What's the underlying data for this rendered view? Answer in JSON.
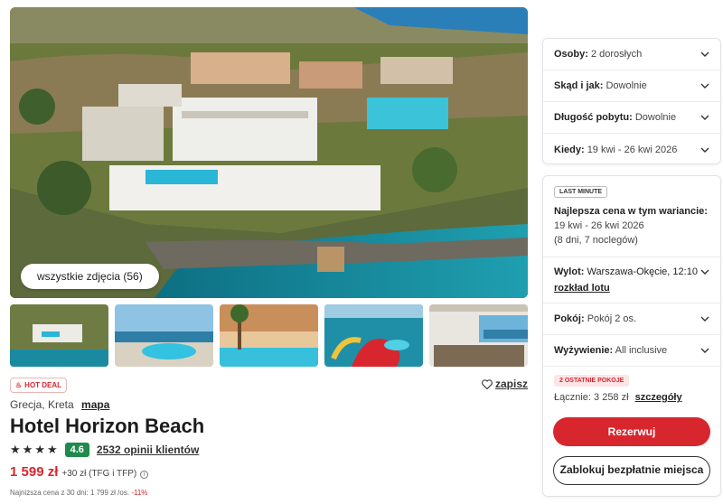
{
  "gallery": {
    "all_photos_label": "wszystkie zdjęcia (56)",
    "thumbnails": [
      "hotel-aerial-thumb",
      "pool-sea-view-thumb",
      "pool-palm-thumb",
      "waterslide-thumb",
      "terrace-restaurant-thumb"
    ]
  },
  "deal": {
    "badge": "HOT DEAL",
    "save_label": "zapisz"
  },
  "location": {
    "text": "Grecja, Kreta",
    "map_link": "mapa"
  },
  "hotel": {
    "name": "Hotel Horizon Beach",
    "stars": 4,
    "score": "4.6",
    "reviews": "2532 opinii klientów"
  },
  "price": {
    "main": "1 599 zł",
    "extra": "+30 zł (TFG i TFP)",
    "lowest_prefix": "Najniższa cena z 30 dni: 1 799 zł /os.",
    "lowest_discount": "-11%"
  },
  "filters": [
    {
      "label": "Osoby:",
      "value": "2 dorosłych"
    },
    {
      "label": "Skąd i jak:",
      "value": "Dowolnie"
    },
    {
      "label": "Długość pobytu:",
      "value": "Dowolnie"
    },
    {
      "label": "Kiedy:",
      "value": "19 kwi - 26 kwi 2026"
    }
  ],
  "offer": {
    "tag": "LAST MINUTE",
    "best_title": "Najlepsza cena w tym wariancie:",
    "dates": "19 kwi - 26 kwi 2026",
    "nights": "(8 dni, 7 noclegów)",
    "flight_label": "Wylot:",
    "flight_value": "Warszawa-Okęcie, 12:10",
    "flight_link": "rozkład lotu",
    "room_label": "Pokój:",
    "room_value": "Pokój 2 os.",
    "board_label": "Wyżywienie:",
    "board_value": "All inclusive",
    "rooms_left": "2 OSTATNIE POKOJE",
    "total": "Łącznie: 3 258 zł",
    "details_link": "szczegóły",
    "reserve_button": "Rezerwuj",
    "block_button": "Zablokuj bezpłatnie miejsca"
  },
  "colors": {
    "accent": "#d8262f",
    "score_green": "#1f8a4c"
  }
}
